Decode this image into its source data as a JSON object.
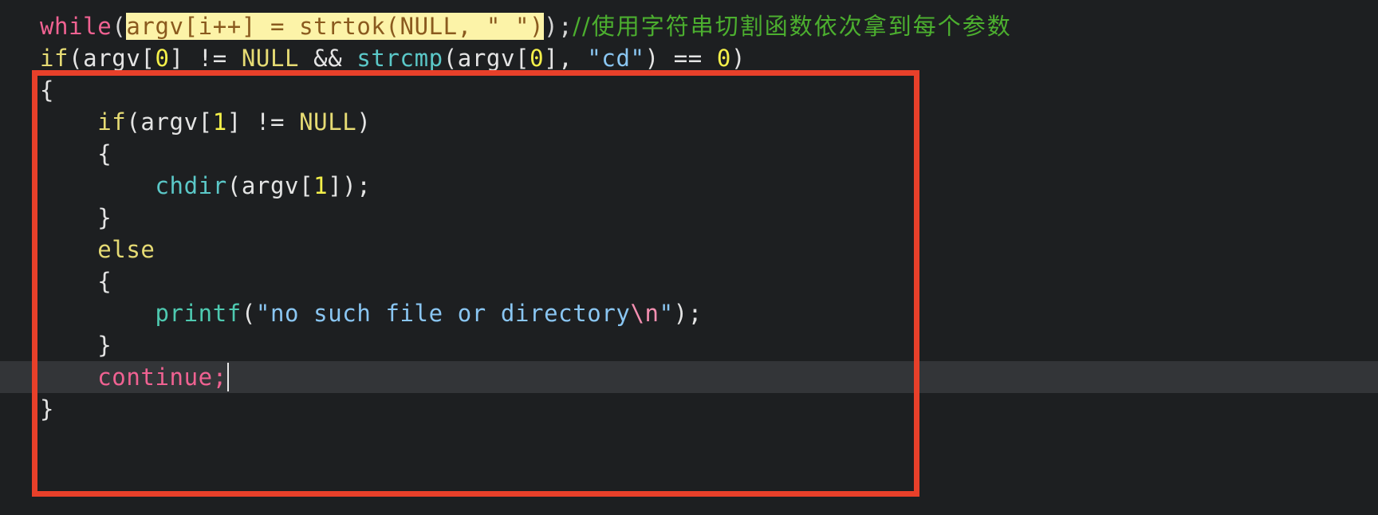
{
  "editor": {
    "background_color": "#1d1f21",
    "current_line_color": "#333538",
    "annotation_box_color": "#e8402a",
    "selection_background": "#fcf3a8",
    "selection_text_color": "#8a5a1e"
  },
  "lines": [
    {
      "id": "line-while",
      "segments": [
        {
          "text": "while",
          "style": "kw-pink"
        },
        {
          "text": "(",
          "style": "punct"
        },
        {
          "text": "argv[i++] = strtok(NULL, \" \")",
          "style": "sel"
        },
        {
          "text": ");",
          "style": "punct"
        },
        {
          "text": "//使用字符串切割函数依次拿到每个参数",
          "style": "comment-green"
        }
      ]
    },
    {
      "id": "line-if-cd",
      "segments": [
        {
          "text": "if",
          "style": "kw-yellow"
        },
        {
          "text": "(argv[",
          "style": "plain"
        },
        {
          "text": "0",
          "style": "num-yellow"
        },
        {
          "text": "] != ",
          "style": "plain"
        },
        {
          "text": "NULL",
          "style": "kw-yellow"
        },
        {
          "text": " && ",
          "style": "plain"
        },
        {
          "text": "strcmp",
          "style": "fn-cyan"
        },
        {
          "text": "(argv[",
          "style": "plain"
        },
        {
          "text": "0",
          "style": "num-yellow"
        },
        {
          "text": "], ",
          "style": "plain"
        },
        {
          "text": "\"cd\"",
          "style": "str-blue"
        },
        {
          "text": ") == ",
          "style": "plain"
        },
        {
          "text": "0",
          "style": "num-yellow"
        },
        {
          "text": ")",
          "style": "plain"
        }
      ]
    },
    {
      "id": "line-open-brace-1",
      "segments": [
        {
          "text": "{",
          "style": "plain"
        }
      ]
    },
    {
      "id": "line-if-argv1",
      "segments": [
        {
          "text": "    ",
          "style": "plain"
        },
        {
          "text": "if",
          "style": "kw-yellow"
        },
        {
          "text": "(argv[",
          "style": "plain"
        },
        {
          "text": "1",
          "style": "num-yellow"
        },
        {
          "text": "] != ",
          "style": "plain"
        },
        {
          "text": "NULL",
          "style": "kw-yellow"
        },
        {
          "text": ")",
          "style": "plain"
        }
      ]
    },
    {
      "id": "line-open-brace-2",
      "segments": [
        {
          "text": "    {",
          "style": "plain"
        }
      ]
    },
    {
      "id": "line-chdir",
      "segments": [
        {
          "text": "        ",
          "style": "plain"
        },
        {
          "text": "chdir",
          "style": "fn-cyan"
        },
        {
          "text": "(argv[",
          "style": "plain"
        },
        {
          "text": "1",
          "style": "num-yellow"
        },
        {
          "text": "]);",
          "style": "plain"
        }
      ]
    },
    {
      "id": "line-close-brace-1",
      "segments": [
        {
          "text": "    }",
          "style": "plain"
        }
      ]
    },
    {
      "id": "line-else",
      "segments": [
        {
          "text": "    ",
          "style": "plain"
        },
        {
          "text": "else",
          "style": "kw-yellow"
        }
      ]
    },
    {
      "id": "line-open-brace-3",
      "segments": [
        {
          "text": "    {",
          "style": "plain"
        }
      ]
    },
    {
      "id": "line-printf",
      "segments": [
        {
          "text": "        ",
          "style": "plain"
        },
        {
          "text": "printf",
          "style": "fn-teal"
        },
        {
          "text": "(",
          "style": "plain"
        },
        {
          "text": "\"no such file or directory",
          "style": "str-blue"
        },
        {
          "text": "\\n",
          "style": "esc-pink"
        },
        {
          "text": "\"",
          "style": "str-blue"
        },
        {
          "text": ");",
          "style": "plain"
        }
      ]
    },
    {
      "id": "line-close-brace-2",
      "segments": [
        {
          "text": "    }",
          "style": "plain"
        }
      ]
    },
    {
      "id": "line-continue",
      "current": true,
      "segments": [
        {
          "text": "    ",
          "style": "plain"
        },
        {
          "text": "continue",
          "style": "kw-pink"
        },
        {
          "text": ";",
          "style": "kw-pink"
        }
      ]
    },
    {
      "id": "line-close-brace-3",
      "segments": [
        {
          "text": "}",
          "style": "plain"
        }
      ]
    }
  ],
  "caret": {
    "visible": true
  },
  "annotation": {
    "shape": "rectangle",
    "color": "#e8402a"
  }
}
